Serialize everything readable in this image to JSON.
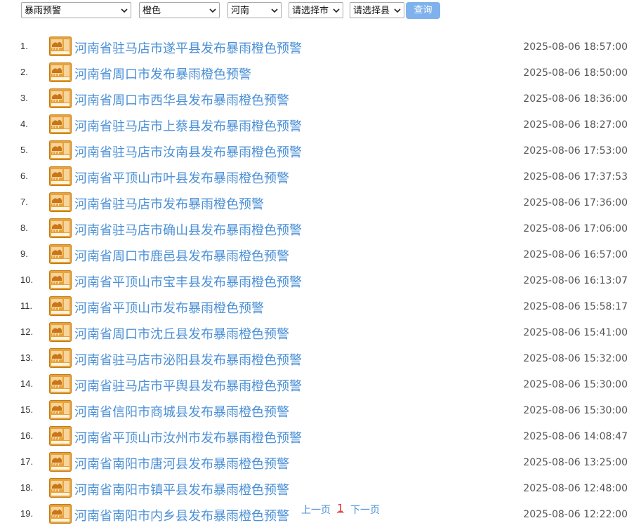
{
  "filters": {
    "type": "暴雨预警",
    "level": "橙色",
    "province": "河南",
    "city": "请选择市",
    "county": "请选择县",
    "query_label": "查询"
  },
  "colors": {
    "link": "#4a8fd6",
    "button": "#7fb2ec",
    "icon_bg": "#e8a23a",
    "current_page": "#e32b2b"
  },
  "icon_name": "rainstorm-orange-warning-icon",
  "items": [
    {
      "index": "1.",
      "title": "河南省驻马店市遂平县发布暴雨橙色预警",
      "time": "2025-08-06 18:57:00"
    },
    {
      "index": "2.",
      "title": "河南省周口市发布暴雨橙色预警",
      "time": "2025-08-06 18:50:00"
    },
    {
      "index": "3.",
      "title": "河南省周口市西华县发布暴雨橙色预警",
      "time": "2025-08-06 18:36:00"
    },
    {
      "index": "4.",
      "title": "河南省驻马店市上蔡县发布暴雨橙色预警",
      "time": "2025-08-06 18:27:00"
    },
    {
      "index": "5.",
      "title": "河南省驻马店市汝南县发布暴雨橙色预警",
      "time": "2025-08-06 17:53:00"
    },
    {
      "index": "6.",
      "title": "河南省平顶山市叶县发布暴雨橙色预警",
      "time": "2025-08-06 17:37:53"
    },
    {
      "index": "7.",
      "title": "河南省驻马店市发布暴雨橙色预警",
      "time": "2025-08-06 17:36:00"
    },
    {
      "index": "8.",
      "title": "河南省驻马店市确山县发布暴雨橙色预警",
      "time": "2025-08-06 17:06:00"
    },
    {
      "index": "9.",
      "title": "河南省周口市鹿邑县发布暴雨橙色预警",
      "time": "2025-08-06 16:57:00"
    },
    {
      "index": "10.",
      "title": "河南省平顶山市宝丰县发布暴雨橙色预警",
      "time": "2025-08-06 16:13:07"
    },
    {
      "index": "11.",
      "title": "河南省平顶山市发布暴雨橙色预警",
      "time": "2025-08-06 15:58:17"
    },
    {
      "index": "12.",
      "title": "河南省周口市沈丘县发布暴雨橙色预警",
      "time": "2025-08-06 15:41:00"
    },
    {
      "index": "13.",
      "title": "河南省驻马店市泌阳县发布暴雨橙色预警",
      "time": "2025-08-06 15:32:00"
    },
    {
      "index": "14.",
      "title": "河南省驻马店市平舆县发布暴雨橙色预警",
      "time": "2025-08-06 15:30:00"
    },
    {
      "index": "15.",
      "title": "河南省信阳市商城县发布暴雨橙色预警",
      "time": "2025-08-06 15:30:00"
    },
    {
      "index": "16.",
      "title": "河南省平顶山市汝州市发布暴雨橙色预警",
      "time": "2025-08-06 14:08:47"
    },
    {
      "index": "17.",
      "title": "河南省南阳市唐河县发布暴雨橙色预警",
      "time": "2025-08-06 13:25:00"
    },
    {
      "index": "18.",
      "title": "河南省南阳市镇平县发布暴雨橙色预警",
      "time": "2025-08-06 12:48:00"
    },
    {
      "index": "19.",
      "title": "河南省南阳市内乡县发布暴雨橙色预警",
      "time": "2025-08-06 12:22:00"
    }
  ],
  "pager": {
    "prev": "上一页",
    "current": "1",
    "next": "下一页"
  }
}
